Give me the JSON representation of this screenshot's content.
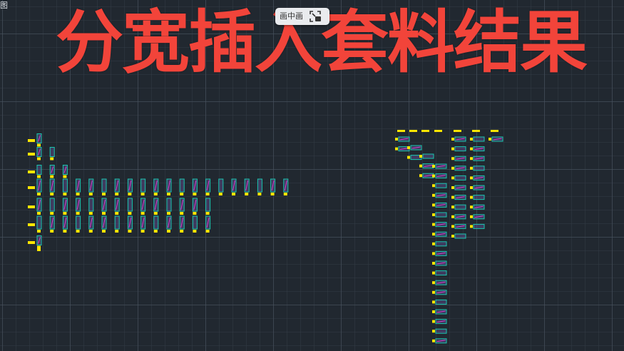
{
  "corner_tag": "图",
  "title": "分宽插入套料结果",
  "pip_button": {
    "label": "画中画",
    "icon": "pip-exit-icon"
  },
  "colors": {
    "background": "#212830",
    "title": "#f2443a",
    "stock_marker": "#ffe600",
    "part_outline": "#18c7b0",
    "part_fill": "#5a4b86",
    "part_hatch": "#d83fd0"
  },
  "nesting_layouts": [
    {
      "name": "horizontal-nesting-layout",
      "rows": [
        1,
        2,
        3,
        20,
        14,
        14,
        1
      ]
    },
    {
      "name": "vertical-nesting-layout",
      "columns": [
        2,
        2,
        3,
        19,
        11,
        10,
        1
      ]
    }
  ]
}
